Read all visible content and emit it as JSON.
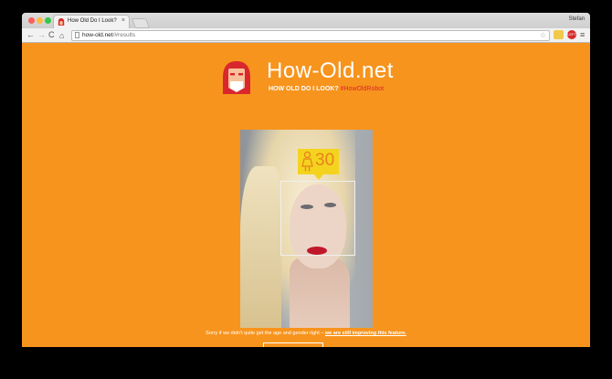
{
  "browser": {
    "tab_title": "How Old Do I Look?",
    "tab_close": "×",
    "profile_name": "Stefan",
    "url_host": "how-old.net",
    "url_path": "/#results",
    "ext_badge": "LEFT",
    "nav": {
      "back": "←",
      "forward": "→",
      "reload": "C",
      "home": "⌂",
      "star": "☆",
      "menu": "≡"
    }
  },
  "site": {
    "title": "How-Old.net",
    "tagline": "HOW OLD DO I LOOK?",
    "hashtag": "#HowOldRobot",
    "brand_color": "#f7941d",
    "accent_red": "#d9272d"
  },
  "result": {
    "age": "30",
    "gender_icon": "female-icon",
    "badge_color": "#f4d31f"
  },
  "footer": {
    "sorry_text": "Sorry if we didn't quite get the age and gender right –",
    "improving_link": "we are still improving this feature."
  }
}
